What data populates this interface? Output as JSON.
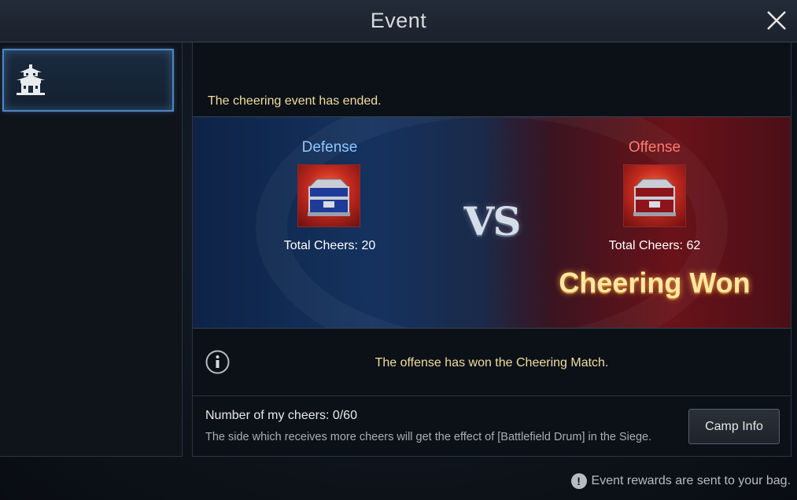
{
  "header": {
    "title": "Event"
  },
  "sidebar": {
    "items": [
      {
        "icon": "pagoda-icon",
        "active": true
      }
    ]
  },
  "main": {
    "status_text": "The cheering event has ended.",
    "defense": {
      "title": "Defense",
      "total_cheers": "Total Cheers: 20",
      "color": "#8ec7ff"
    },
    "offense": {
      "title": "Offense",
      "total_cheers": "Total Cheers: 62",
      "color": "#ff7b6e"
    },
    "vs_label": "VS",
    "result_label": "Cheering Won",
    "info_message": "The offense has won the Cheering Match.",
    "my_cheers": "Number of my cheers: 0/60",
    "note": "The side which receives more cheers will get the effect of [Battlefield Drum] in the Siege.",
    "camp_info_button": "Camp Info"
  },
  "footer": {
    "note": "Event rewards are sent to your bag."
  }
}
